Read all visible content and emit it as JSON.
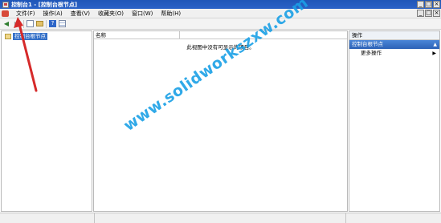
{
  "window": {
    "title": "控制台1 - [控制台根节点]",
    "controls": [
      "_",
      "□",
      "×"
    ]
  },
  "menubar": {
    "items": [
      "文件(F)",
      "操作(A)",
      "查看(V)",
      "收藏夹(O)",
      "窗口(W)",
      "帮助(H)"
    ],
    "controls": [
      "_",
      "□",
      "×"
    ]
  },
  "toolbar": {
    "icons": [
      "back-icon",
      "forward-icon",
      "show-tree-icon",
      "folder-icon",
      "help-icon",
      "list-icon"
    ]
  },
  "tree": {
    "root_label": "控制台根节点"
  },
  "list": {
    "column_name": "名称",
    "empty_message": "此视图中没有可显示的项目。"
  },
  "actions": {
    "header": "操作",
    "section_title": "控制台根节点",
    "item": "更多操作",
    "collapse_glyph": "▲",
    "more_glyph": "▶"
  },
  "watermark": {
    "text": "www.solidworkszxw.com",
    "color": "#1aa0e6"
  },
  "colors": {
    "titlebar": "#2a62c6",
    "selection": "#3470c8",
    "annotation_arrow": "#d62a2a"
  }
}
